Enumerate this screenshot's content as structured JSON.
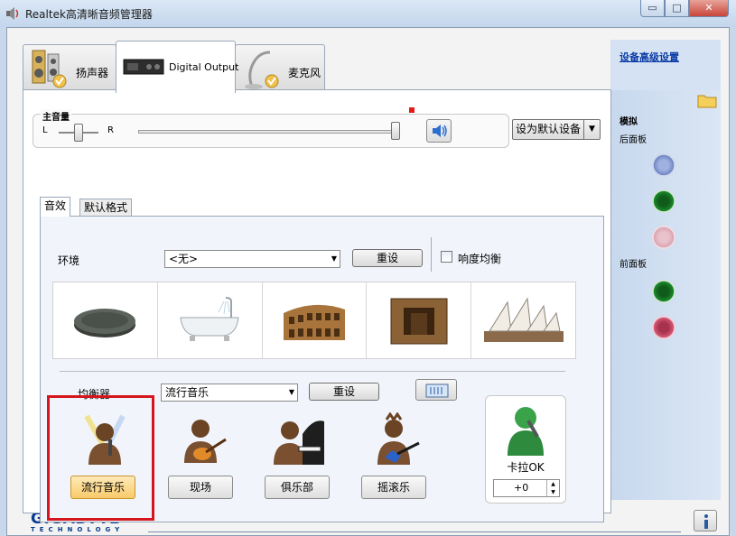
{
  "window": {
    "title": "Realtek高清晰音频管理器",
    "min_glyph": "▭",
    "max_glyph": "□",
    "close_glyph": "✕"
  },
  "device_tabs": [
    {
      "label": "扬声器",
      "icon": "speaker-icon"
    },
    {
      "label": "Digital Output",
      "icon": "digital-output-icon"
    },
    {
      "label": "麦克风",
      "icon": "microphone-icon"
    }
  ],
  "master_volume": {
    "title": "主音量",
    "left_label": "L",
    "right_label": "R",
    "balance": 0.5,
    "level": 1.0
  },
  "default_device_button": "设为默认设备",
  "sub_tabs": [
    "音效",
    "默认格式"
  ],
  "effects": {
    "environment_label": "环境",
    "environment_value": "<无>",
    "environment_reset": "重设",
    "loudness_label": "响度均衡",
    "loudness_checked": false,
    "environment_icons": [
      "stone-icon",
      "bathtub-icon",
      "colosseum-icon",
      "stone-corridor-icon",
      "opera-house-icon"
    ]
  },
  "equalizer": {
    "label": "均衡器",
    "value": "流行音乐",
    "reset": "重设",
    "presets": [
      {
        "label": "流行音乐",
        "icon": "pop-singer-icon",
        "selected": true
      },
      {
        "label": "现场",
        "icon": "live-guitarist-icon",
        "selected": false
      },
      {
        "label": "俱乐部",
        "icon": "club-pianist-icon",
        "selected": false
      },
      {
        "label": "摇滚乐",
        "icon": "rock-guitarist-icon",
        "selected": false
      }
    ]
  },
  "karaoke": {
    "label": "卡拉OK",
    "value": "+0"
  },
  "right_panel": {
    "advanced_link": "设备高级设置",
    "analog_label": "模拟",
    "back_panel_label": "后面板",
    "front_panel_label": "前面板"
  },
  "brand": {
    "name": "GIGABYTE",
    "tm": "™",
    "sub": "TECHNOLOGY"
  },
  "colors": {
    "jack_blue": "#6f86c4",
    "jack_green": "#1d8a2c",
    "jack_pink_dim": "#d9a4b3",
    "jack_pink": "#d65a78",
    "selection_red": "#d5161c"
  }
}
